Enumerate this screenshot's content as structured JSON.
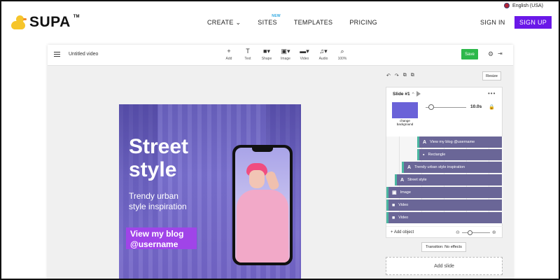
{
  "site": {
    "language": "English (USA)",
    "logo_text": "SUPA",
    "logo_tm": "TM",
    "nav": [
      {
        "label": "CREATE",
        "chevron": "⌄"
      },
      {
        "label": "SITES",
        "badge": "NEW"
      },
      {
        "label": "TEMPLATES"
      },
      {
        "label": "PRICING"
      }
    ],
    "signin": "SIGN IN",
    "signup": "SIGN UP"
  },
  "editor": {
    "doc_title": "Untitled video",
    "tools": [
      {
        "icon": "+",
        "label": "Add",
        "icon_name": "plus-icon"
      },
      {
        "icon": "T",
        "label": "Text",
        "icon_name": "text-icon"
      },
      {
        "icon": "■▾",
        "label": "Shape",
        "icon_name": "shape-icon"
      },
      {
        "icon": "▣▾",
        "label": "Image",
        "icon_name": "image-icon"
      },
      {
        "icon": "▬▾",
        "label": "Video",
        "icon_name": "video-icon"
      },
      {
        "icon": "♫▾",
        "label": "Audio",
        "icon_name": "audio-icon"
      },
      {
        "icon": "⌕",
        "label": "100%",
        "icon_name": "zoom-icon"
      }
    ],
    "save": "Save",
    "resize": "Resize"
  },
  "canvas": {
    "headline_line1": "Street",
    "headline_line2": "style",
    "sub_line1": "Trendy urban",
    "sub_line2": "style inspiration",
    "cta_line1": "View my blog",
    "cta_line2": "@username"
  },
  "panel": {
    "slide_title": "Slide #1",
    "swatch_label": "change background",
    "duration": "10.0s",
    "layers": [
      {
        "icon": "A",
        "label": "View my blog @username"
      },
      {
        "icon": "▪",
        "label": "Rectangle"
      },
      {
        "icon": "A",
        "label": "Trendy urban style inspiration"
      },
      {
        "icon": "A",
        "label": "Street style"
      },
      {
        "icon": "▣",
        "label": "Image"
      },
      {
        "icon": "■",
        "label": "Video"
      },
      {
        "icon": "■",
        "label": "Video"
      }
    ],
    "add_object": "+ Add object",
    "transition": "Transition: No effects",
    "add_slide": "Add slide"
  },
  "colors": {
    "signup": "#6a18e8",
    "save": "#2db84b",
    "cta": "#a044e8",
    "layer": "#6a6697",
    "swatch": "#6a62d8"
  }
}
